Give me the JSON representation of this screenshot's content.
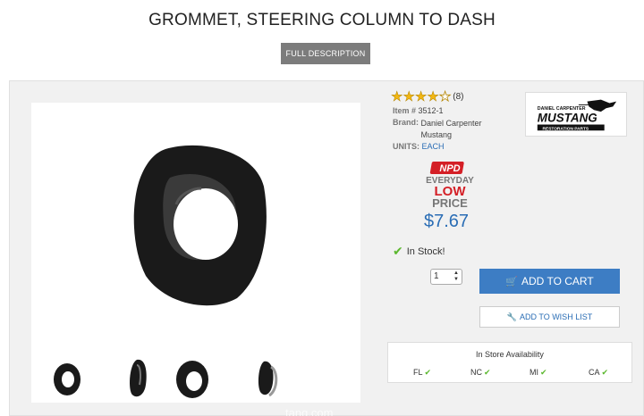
{
  "product": {
    "title": "GROMMET, STEERING COLUMN TO DASH",
    "full_description_label": "FULL DESCRIPTION",
    "rating_value": 4,
    "rating_max": 5,
    "rating_count": "(8)",
    "item_label": "Item #",
    "item_number": "3512-1",
    "brand_label": "Brand:",
    "brand_name": "Daniel Carpenter Mustang",
    "units_label": "UNITS:",
    "units_value": "EACH",
    "price": "$7.67",
    "stock_status": "In Stock!",
    "quantity": "1",
    "add_to_cart_label": "ADD TO CART",
    "add_to_wishlist_label": "ADD TO WISH LIST"
  },
  "brand_logo": {
    "line1": "DANIEL CARPENTER",
    "line2": "MUSTANG",
    "line3": "RESTORATION PARTS"
  },
  "price_badge": {
    "line1": "NPD",
    "line2": "EVERYDAY",
    "line3": "LOW",
    "line4": "PRICE"
  },
  "availability": {
    "title": "In Store Availability",
    "stores": [
      {
        "code": "FL",
        "available": true
      },
      {
        "code": "NC",
        "available": true
      },
      {
        "code": "MI",
        "available": true
      },
      {
        "code": "CA",
        "available": true
      }
    ]
  },
  "watermark": "tang.com",
  "colors": {
    "accent_blue": "#3d7dc4",
    "price_blue": "#2a6db5",
    "star_gold": "#f2b713",
    "check_green": "#5cb82f",
    "badge_red": "#d41f26"
  },
  "icons": [
    "star-icon",
    "check-icon",
    "cart-icon",
    "wrench-icon",
    "updown-arrows-icon"
  ]
}
